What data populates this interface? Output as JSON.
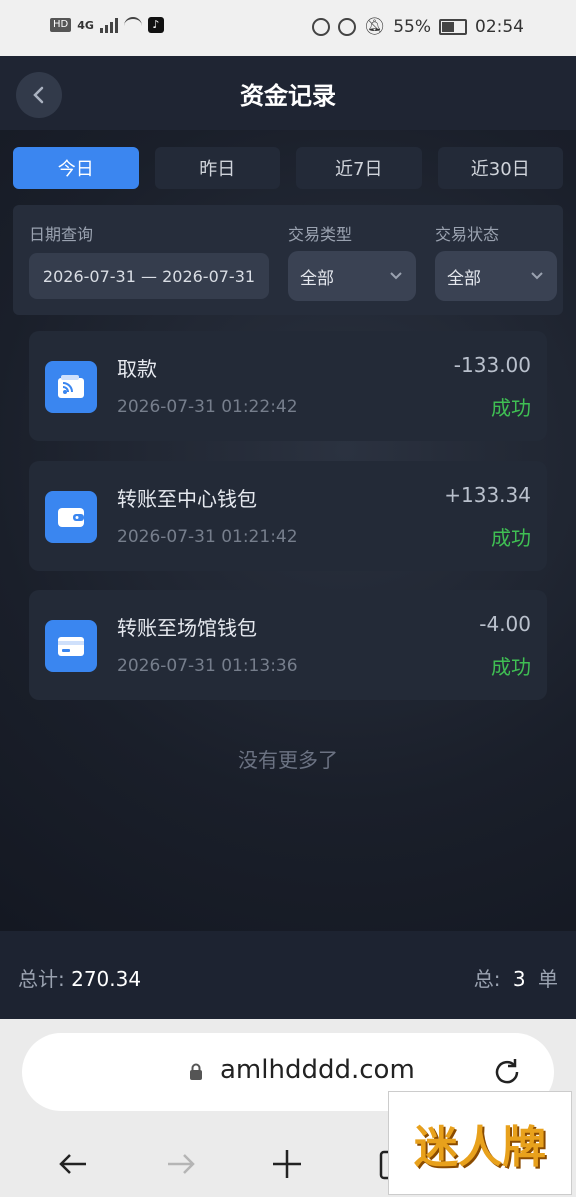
{
  "status_bar": {
    "left_icons": [
      "HD",
      "4G"
    ],
    "battery": "55%",
    "time": "02:54"
  },
  "header": {
    "title": "资金记录"
  },
  "tabs": [
    {
      "label": "今日",
      "active": true
    },
    {
      "label": "昨日",
      "active": false
    },
    {
      "label": "近7日",
      "active": false
    },
    {
      "label": "近30日",
      "active": false
    }
  ],
  "filters": {
    "date_label": "日期查询",
    "date_value": "2026-07-31 — 2026-07-31",
    "type_label": "交易类型",
    "type_value": "全部",
    "status_label": "交易状态",
    "status_value": "全部"
  },
  "records": [
    {
      "title": "取款",
      "time": "2026-07-31 01:22:42",
      "amount": "-133.00",
      "status": "成功",
      "icon": "wallet-icon"
    },
    {
      "title": "转账至中心钱包",
      "time": "2026-07-31 01:21:42",
      "amount": "+133.34",
      "status": "成功",
      "icon": "purse-icon"
    },
    {
      "title": "转账至场馆钱包",
      "time": "2026-07-31 01:13:36",
      "amount": "-4.00",
      "status": "成功",
      "icon": "card-icon"
    }
  ],
  "no_more": "没有更多了",
  "summary": {
    "total_label": "总计:",
    "total_value": "270.34",
    "count_label": "总:",
    "count_value": "3",
    "count_unit": "单"
  },
  "browser": {
    "url": "amlhdddd.com"
  },
  "watermark": {
    "text": "迷人牌"
  },
  "colors": {
    "accent": "#3b86f0",
    "success": "#3fbf53",
    "background": "#1b2130"
  }
}
